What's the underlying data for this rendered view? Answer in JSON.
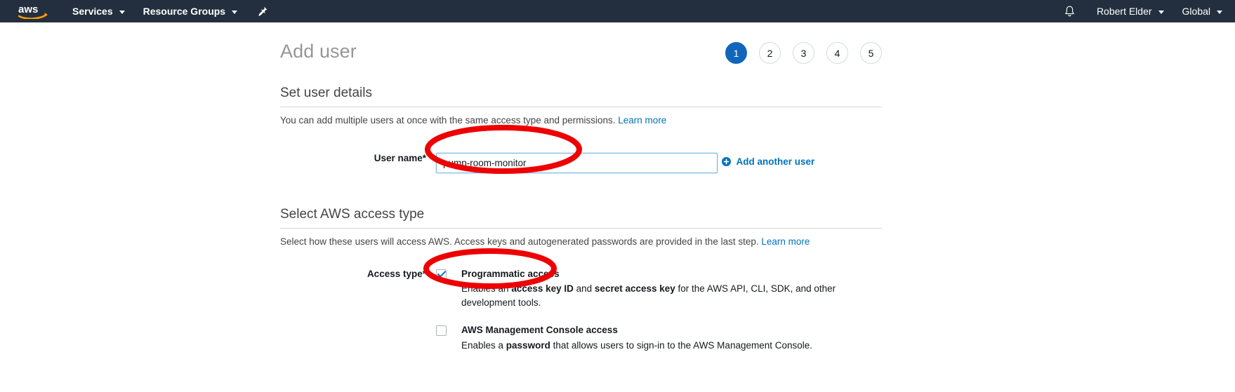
{
  "navbar": {
    "logo_alt": "aws",
    "services_label": "Services",
    "resource_groups_label": "Resource Groups",
    "pin_icon": "pin-icon",
    "bell_icon": "bell-icon",
    "account_label": "Robert Elder",
    "region_label": "Global"
  },
  "page": {
    "title": "Add user"
  },
  "steps": [
    {
      "number": "1",
      "active": true
    },
    {
      "number": "2",
      "active": false
    },
    {
      "number": "3",
      "active": false
    },
    {
      "number": "4",
      "active": false
    },
    {
      "number": "5",
      "active": false
    }
  ],
  "user_details": {
    "heading": "Set user details",
    "description": "You can add multiple users at once with the same access type and permissions.",
    "learn_more": "Learn more",
    "username_label": "User name*",
    "username_value": "pump-room-monitor",
    "username_placeholder": "",
    "add_another_label": "Add another user",
    "add_another_icon": "plus-circle-icon"
  },
  "access_type": {
    "heading": "Select AWS access type",
    "description": "Select how these users will access AWS. Access keys and autogenerated passwords are provided in the last step.",
    "learn_more": "Learn more",
    "label": "Access type*",
    "options": [
      {
        "title": "Programmatic access",
        "checked": true,
        "desc_parts": [
          {
            "text": "Enables an ",
            "bold": false
          },
          {
            "text": "access key ID",
            "bold": true
          },
          {
            "text": " and ",
            "bold": false
          },
          {
            "text": "secret access key",
            "bold": true
          },
          {
            "text": " for the AWS API, CLI, SDK, and other development tools.",
            "bold": false
          }
        ],
        "desc_plain": "Enables an access key ID and secret access key for the AWS API, CLI, SDK, and other development tools."
      },
      {
        "title": "AWS Management Console access",
        "checked": false,
        "desc_parts": [
          {
            "text": "Enables a ",
            "bold": false
          },
          {
            "text": "password",
            "bold": true
          },
          {
            "text": " that allows users to sign-in to the AWS Management Console.",
            "bold": false
          }
        ],
        "desc_plain": "Enables a password that allows users to sign-in to the AWS Management Console."
      }
    ]
  },
  "annotations": [
    {
      "name": "username-field-highlight",
      "shape": "ellipse",
      "color": "#ee0000"
    },
    {
      "name": "programmatic-access-highlight",
      "shape": "ellipse",
      "color": "#ee0000"
    }
  ],
  "colors": {
    "nav_bg": "#232f3e",
    "accent_blue": "#0073bb",
    "step_active": "#1166bb",
    "annotation_red": "#ee0000",
    "logo_orange": "#ff9900"
  }
}
